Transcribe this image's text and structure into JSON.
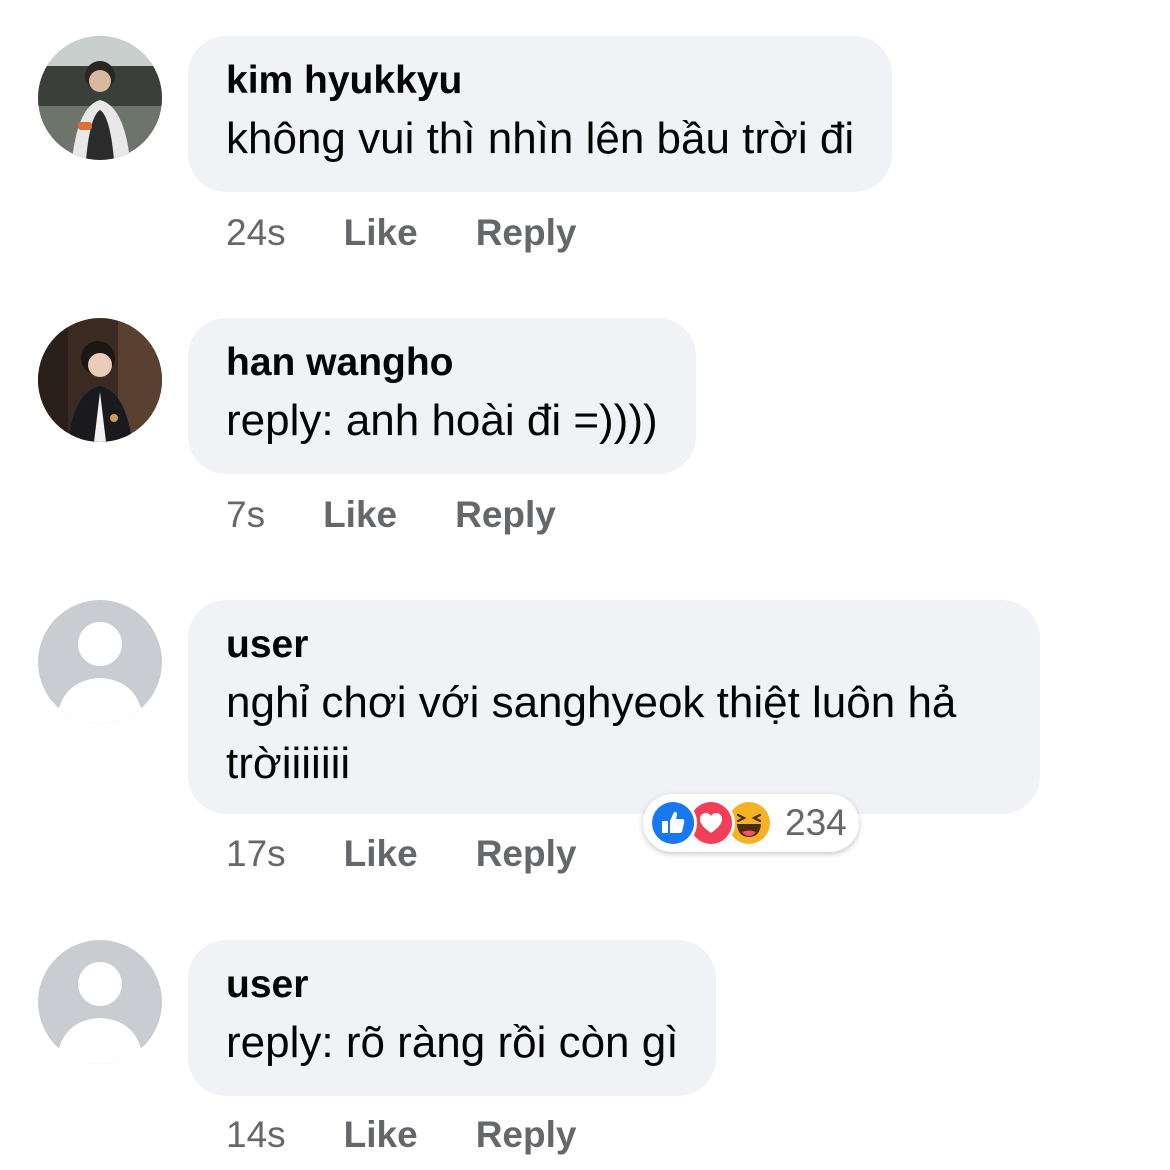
{
  "comments": [
    {
      "author": "kim hyukkyu",
      "text": "không vui thì nhìn lên bầu trời đi",
      "time": "24s",
      "like_label": "Like",
      "reply_label": "Reply",
      "avatar": "photo-avatar"
    },
    {
      "author": "han wangho",
      "text": "reply: anh hoài đi =))))",
      "time": "7s",
      "like_label": "Like",
      "reply_label": "Reply",
      "avatar": "photo-avatar"
    },
    {
      "author": "user",
      "text": "nghỉ chơi với sanghyeok thiệt luôn hả trờiiiiiii",
      "time": "17s",
      "like_label": "Like",
      "reply_label": "Reply",
      "avatar": "default-avatar",
      "reactions": {
        "icons": [
          "like-reaction-icon",
          "love-reaction-icon",
          "haha-reaction-icon"
        ],
        "count": "234"
      }
    },
    {
      "author": "user",
      "text": "reply: rõ ràng rồi còn gì",
      "time": "14s",
      "like_label": "Like",
      "reply_label": "Reply",
      "avatar": "default-avatar"
    }
  ],
  "colors": {
    "bubble_bg": "#f0f2f5",
    "meta_text": "#65676b",
    "like_blue": "#1877f2",
    "love_red": "#f33e58",
    "haha_yellow": "#f7b125"
  }
}
